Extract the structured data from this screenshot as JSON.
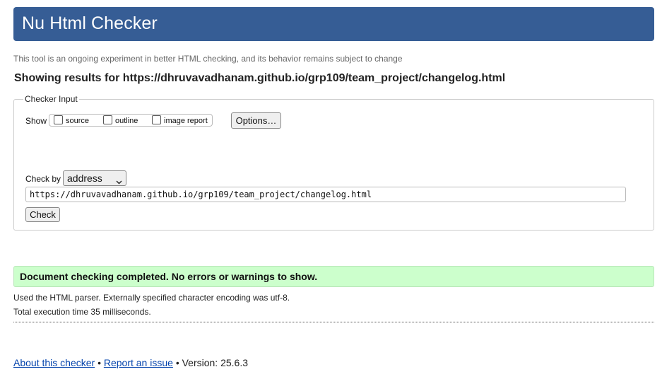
{
  "banner": {
    "title": "Nu Html Checker"
  },
  "tagline": "This tool is an ongoing experiment in better HTML checking, and its behavior remains subject to change",
  "showing": "Showing results for https://dhruvavadhanam.github.io/grp109/team_project/changelog.html",
  "checker_input": {
    "legend": "Checker Input",
    "show_label": "Show",
    "checkboxes": [
      {
        "label": "source",
        "checked": false
      },
      {
        "label": "outline",
        "checked": false
      },
      {
        "label": "image report",
        "checked": false
      }
    ],
    "options_button": "Options…",
    "check_by_label": "Check by",
    "check_by_value": "address",
    "url_value": "https://dhruvavadhanam.github.io/grp109/team_project/changelog.html",
    "check_button": "Check"
  },
  "result": {
    "message": "Document checking completed. No errors or warnings to show.",
    "parser_info": "Used the HTML parser. Externally specified character encoding was utf-8.",
    "execution_time": "Total execution time 35 milliseconds."
  },
  "footer": {
    "about_link": "About this checker",
    "separator": "•",
    "report_link": "Report an issue",
    "version": "Version: 25.6.3"
  },
  "colors": {
    "banner": "#365d95",
    "success_bg": "#ccffcc",
    "link": "#0645ad"
  }
}
